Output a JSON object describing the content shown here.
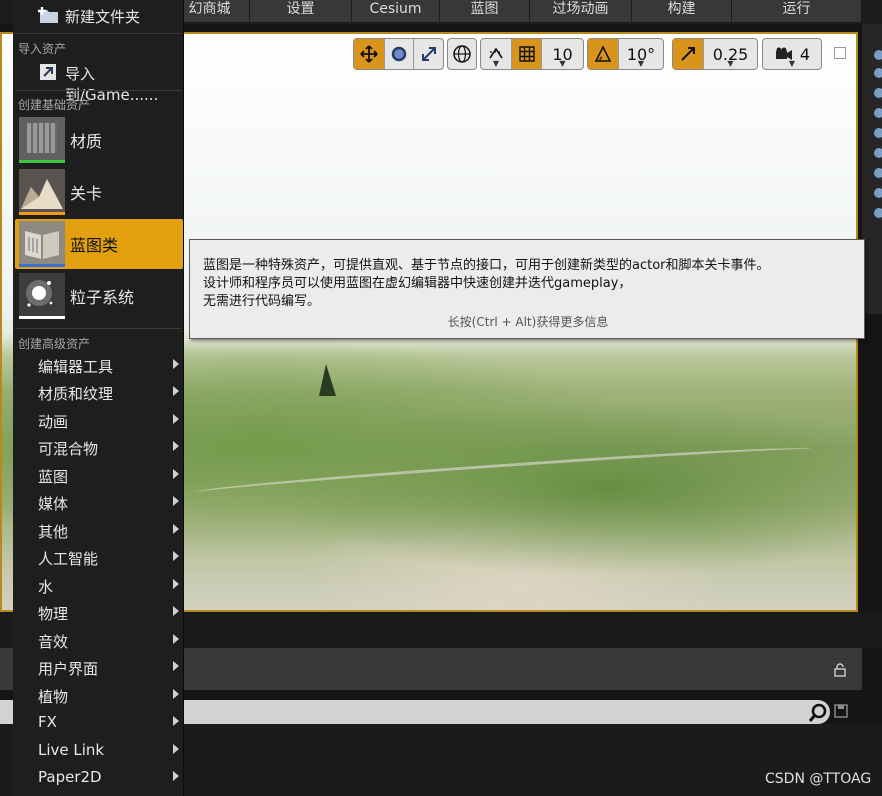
{
  "toolbar": {
    "items": [
      "幻商城",
      "设置",
      "Cesium",
      "蓝图",
      "过场动画",
      "构建",
      "运行"
    ]
  },
  "viewport_toolbar": {
    "grid_snap_value": "10",
    "rotation_snap_value": "10°",
    "scale_snap_value": "0.25",
    "camera_speed_value": "4"
  },
  "menu": {
    "new_folder": "新建文件夹",
    "import_section": "导入资产",
    "import_item": "导入到/Game......",
    "basic_section": "创建基础资产",
    "basic_items": [
      {
        "label": "材质",
        "bar_color": "#3ec43e"
      },
      {
        "label": "关卡",
        "bar_color": "#f39a1c"
      },
      {
        "label": "蓝图类",
        "bar_color": "#3a6fd8"
      },
      {
        "label": "粒子系统",
        "bar_color": "#ffffff"
      }
    ],
    "advanced_section": "创建高级资产",
    "advanced_items": [
      "编辑器工具",
      "材质和纹理",
      "动画",
      "可混合物",
      "蓝图",
      "媒体",
      "其他",
      "人工智能",
      "水",
      "物理",
      "音效",
      "用户界面",
      "植物",
      "FX",
      "Live Link",
      "Paper2D"
    ]
  },
  "tooltip": {
    "line1": "蓝图是一种特殊资产，可提供直观、基于节点的接口，可用于创建新类型的actor和脚本关卡事件。",
    "line2": "设计师和程序员可以使用蓝图在虚幻编辑器中快速创建并迭代gameplay，",
    "line3": "无需进行代码编写。",
    "hint": "长按(Ctrl + Alt)获得更多信息"
  },
  "colors": {
    "accent": "#e2a011",
    "viewport_border": "#b88a1e"
  },
  "watermark": "CSDN @TTOAG"
}
